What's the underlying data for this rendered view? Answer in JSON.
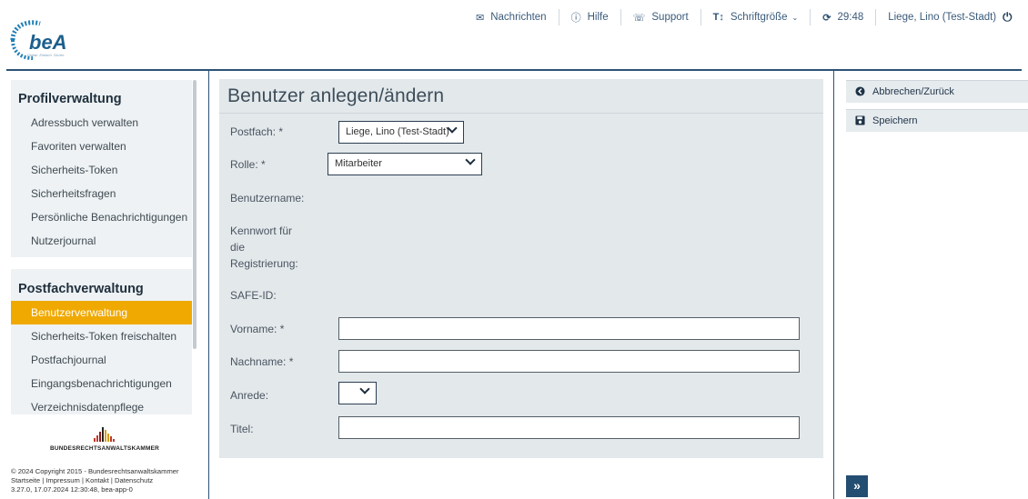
{
  "logo": {
    "text": "beA",
    "tagline": "Digital. Einfach. Sicher."
  },
  "topnav": {
    "messages": "Nachrichten",
    "help": "Hilfe",
    "support": "Support",
    "font_size": "Schriftgröße",
    "timer": "29:48",
    "user": "Liege, Lino (Test-Stadt)"
  },
  "sidebar": {
    "profil_title": "Profilverwaltung",
    "profil_items": [
      "Adressbuch verwalten",
      "Favoriten verwalten",
      "Sicherheits-Token",
      "Sicherheitsfragen",
      "Persönliche Benachrichtigungen",
      "Nutzerjournal"
    ],
    "postfach_title": "Postfachverwaltung",
    "postfach_items": [
      "Benutzerverwaltung",
      "Sicherheits-Token freischalten",
      "Postfachjournal",
      "Eingangsbenachrichtigungen",
      "Verzeichnisdatenpflege"
    ],
    "active_item": "Benutzerverwaltung"
  },
  "brak": {
    "name": "BUNDESRECHTSANWALTSKAMMER"
  },
  "footer": {
    "copyright": "© 2024 Copyright 2015 - Bundesrechtsanwaltskammer",
    "links": [
      "Startseite",
      "Impressum",
      "Kontakt",
      "Datenschutz"
    ],
    "version": "3.27.0, 17.07.2024 12:30:48, bea-app-0"
  },
  "form": {
    "title": "Benutzer anlegen/ändern",
    "postfach_label": "Postfach: *",
    "postfach_value": "Liege, Lino (Test-Stadt)",
    "rolle_label": "Rolle: *",
    "rolle_value": "Mitarbeiter",
    "benutzername_label": "Benutzername:",
    "kennwort_label_1": "Kennwort für",
    "kennwort_label_2": "die",
    "kennwort_label_3": "Registrierung:",
    "safe_id_label": "SAFE-ID:",
    "vorname_label": "Vorname: *",
    "vorname_value": "",
    "nachname_label": "Nachname: *",
    "nachname_value": "",
    "anrede_label": "Anrede:",
    "anrede_value": "",
    "titel_label": "Titel:",
    "titel_value": ""
  },
  "actions": {
    "back": "Abbrechen/Zurück",
    "save": "Speichern"
  },
  "colors": {
    "accent": "#f0a900",
    "navy": "#2e5275",
    "panel": "#e3e8eb"
  }
}
